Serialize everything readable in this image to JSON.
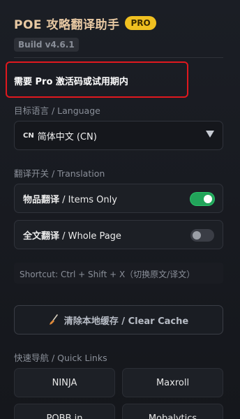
{
  "header": {
    "app_title": "POE 攻略翻译助手",
    "pro_badge": "PRO",
    "build": "Build v4.6.1"
  },
  "notice": "需要 Pro 激活码或试用期内",
  "language": {
    "section_label": "目标语言 / Language",
    "prefix": "CN",
    "selected": "简体中文 (CN)"
  },
  "translation": {
    "section_label": "翻译开关 / Translation",
    "toggles": [
      {
        "label_cn": "物品翻译",
        "label_en": " / Items Only",
        "on": true
      },
      {
        "label_cn": "全文翻译",
        "label_en": " / Whole Page",
        "on": false
      }
    ]
  },
  "shortcut": "Shortcut: Ctrl + Shift + X（切换原文/译文）",
  "clear_cache": "清除本地缓存 / Clear Cache",
  "quick_links": {
    "section_label": "快速导航 / Quick Links",
    "links": [
      "NINJA",
      "Maxroll",
      "POBB.in",
      "Mobalytics"
    ]
  },
  "colors": {
    "accent_gold": "#f0c020",
    "title": "#e8c9a3",
    "toggle_on": "#22a45a",
    "highlight_border": "#e0181e"
  }
}
